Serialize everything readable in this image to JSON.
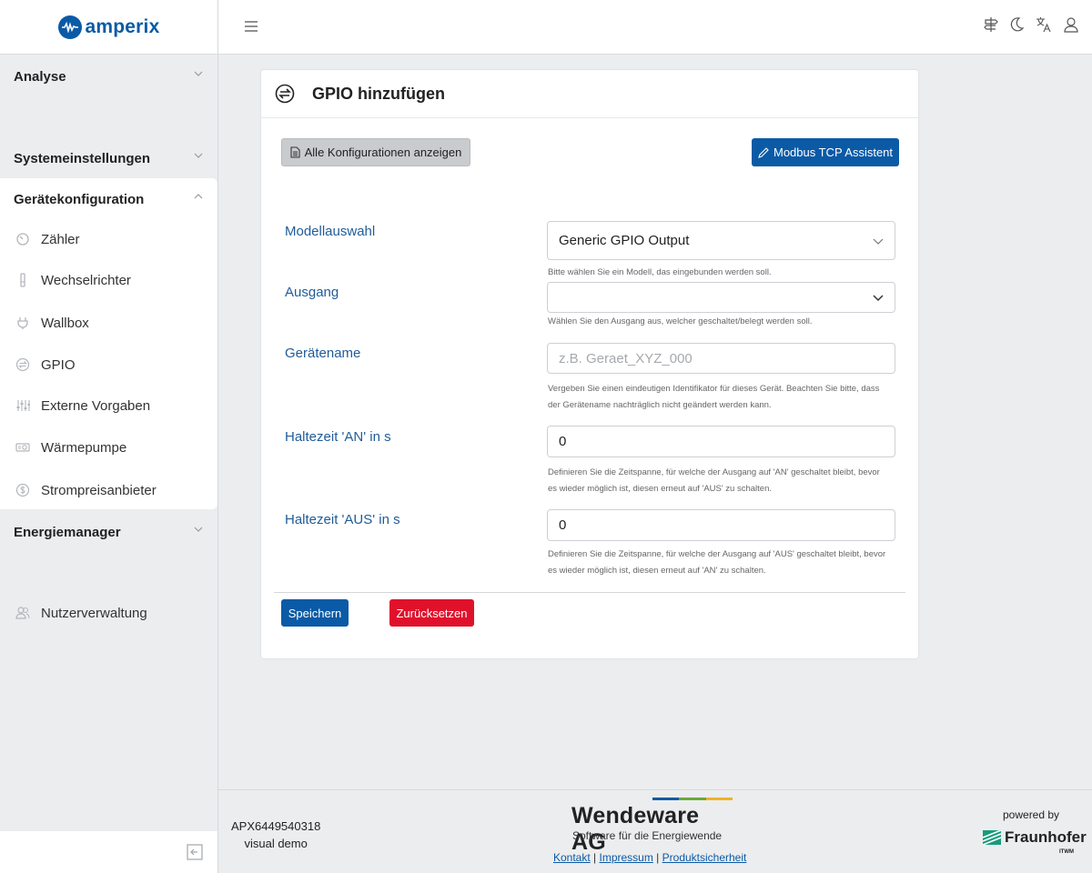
{
  "brand": {
    "name": "amperix",
    "color": "#0b5aa6"
  },
  "sidebar": {
    "sections": [
      {
        "label": "Analyse",
        "expanded": false
      },
      {
        "label": "Systemeinstellungen",
        "expanded": false
      },
      {
        "label": "Gerätekonfiguration",
        "expanded": true
      },
      {
        "label": "Energiemanager",
        "expanded": false
      }
    ],
    "items": [
      {
        "label": "Zähler",
        "icon": "meter-icon"
      },
      {
        "label": "Wechselrichter",
        "icon": "inverter-icon"
      },
      {
        "label": "Wallbox",
        "icon": "plug-icon"
      },
      {
        "label": "GPIO",
        "icon": "swap-icon"
      },
      {
        "label": "Externe Vorgaben",
        "icon": "sliders-icon"
      },
      {
        "label": "Wärmepumpe",
        "icon": "heatpump-icon"
      },
      {
        "label": "Strompreisanbieter",
        "icon": "coin-icon"
      }
    ],
    "user_admin": {
      "label": "Nutzerverwaltung",
      "icon": "users-icon"
    }
  },
  "topbar": {
    "icons": [
      "signpost-icon",
      "moon-icon",
      "translate-icon",
      "user-icon"
    ]
  },
  "card": {
    "title": "GPIO hinzufügen",
    "show_configs_button": "Alle Konfigurationen anzeigen",
    "modbus_button": "Modbus TCP Assistent",
    "fields": {
      "model": {
        "label": "Modellauswahl",
        "value": "Generic GPIO Output",
        "help": "Bitte wählen Sie ein Modell, das eingebunden werden soll."
      },
      "output": {
        "label": "Ausgang",
        "value": "",
        "help": "Wählen Sie den Ausgang aus, welcher geschaltet/belegt werden soll."
      },
      "device_name": {
        "label": "Gerätename",
        "placeholder": "z.B. Geraet_XYZ_000",
        "help1": "Vergeben Sie einen eindeutigen Identifikator für dieses Gerät. Beachten Sie bitte, dass",
        "help2": "der Gerätename nachträglich nicht geändert werden kann."
      },
      "hold_on": {
        "label": "Haltezeit 'AN' in s",
        "value": "0",
        "help1": "Definieren Sie die Zeitspanne, für welche der Ausgang auf 'AN' geschaltet bleibt, bevor",
        "help2": "es wieder möglich ist, diesen erneut auf 'AUS' zu schalten."
      },
      "hold_off": {
        "label": "Haltezeit 'AUS' in s",
        "value": "0",
        "help1": "Definieren Sie die Zeitspanne, für welche der Ausgang auf 'AUS' geschaltet bleibt, bevor",
        "help2": "es wieder möglich ist, diesen erneut auf 'AN' zu schalten."
      }
    },
    "save_button": "Speichern",
    "reset_button": "Zurücksetzen"
  },
  "footer": {
    "device_id": "APX6449540318",
    "mode": "visual demo",
    "company": "Wendeware AG",
    "tagline": "Software für die Energiewende",
    "links": [
      "Kontakt",
      "Impressum",
      "Produktsicherheit"
    ],
    "powered_by": "powered by",
    "partner": "Fraunhofer",
    "partner_sub": "ITWM",
    "bar_colors": [
      "#0b5aa6",
      "#6aa83a",
      "#f0b323"
    ]
  },
  "colors": {
    "accent": "#0b5aa6",
    "danger": "#e0112b",
    "label": "#1f5c99"
  }
}
